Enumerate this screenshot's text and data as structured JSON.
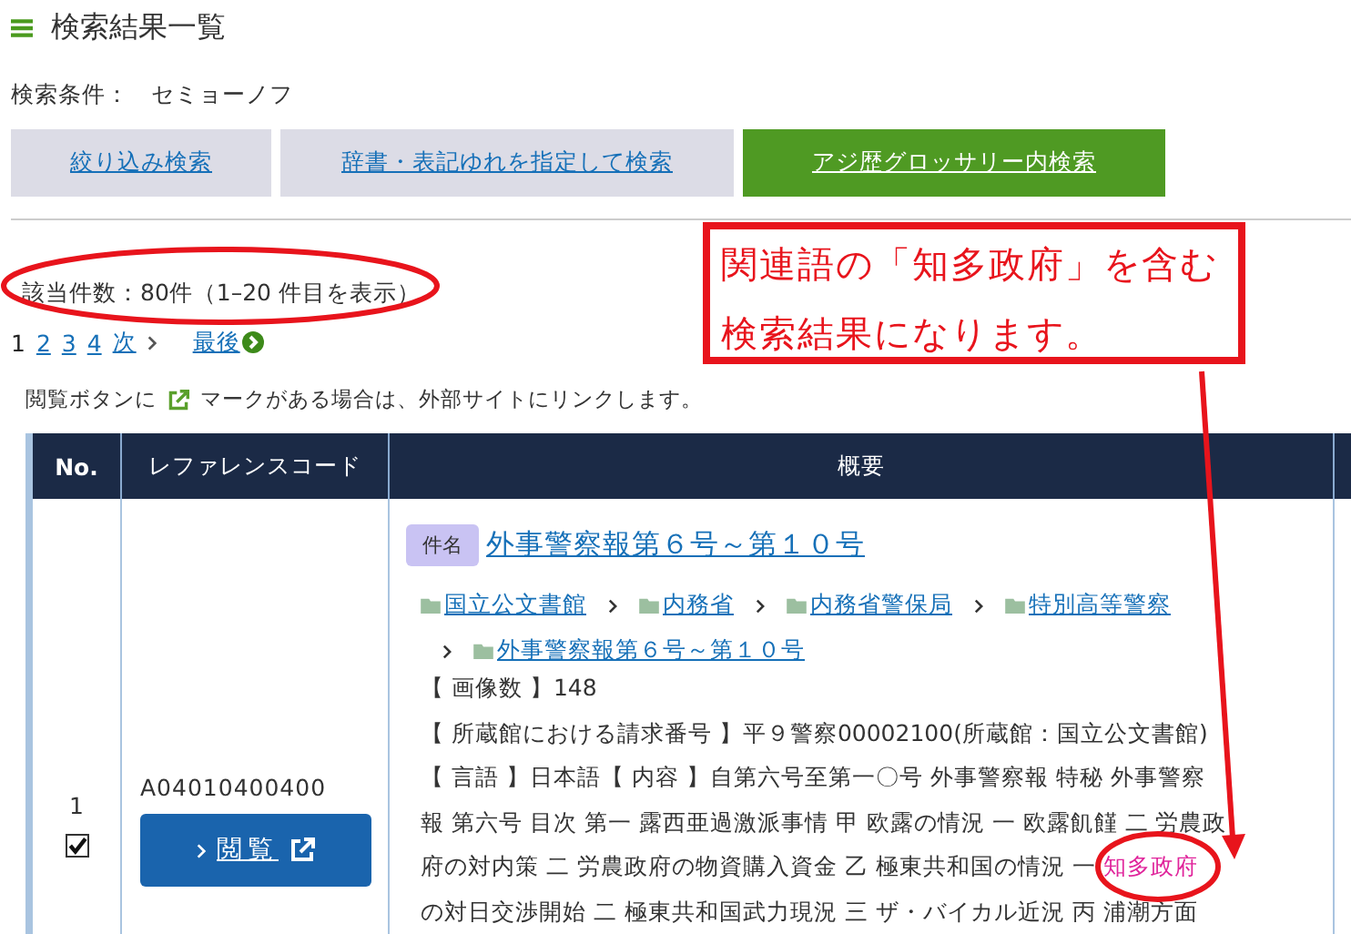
{
  "page_title": "検索結果一覧",
  "condition": {
    "label": "検索条件：",
    "value": "セミョーノフ"
  },
  "search_buttons": [
    {
      "label": "絞り込み検索",
      "selected": false
    },
    {
      "label": "辞書・表記ゆれを指定して検索",
      "selected": false
    },
    {
      "label": "アジ歴グロッサリー内検索",
      "selected": true
    }
  ],
  "result_count": "該当件数：80件（1–20 件目を表示）",
  "pagination": [
    {
      "label": "1",
      "selected": true
    },
    {
      "label": "2",
      "selected": false
    },
    {
      "label": "3",
      "selected": false
    },
    {
      "label": "4",
      "selected": false
    },
    {
      "label": "次",
      "selected": false
    }
  ],
  "last_link": "最後",
  "note": {
    "before": "閲覧ボタンに",
    "after": "マークがある場合は、外部サイトにリンクします。"
  },
  "table": {
    "columns": [
      "No.",
      "レファレンスコード",
      "概要"
    ],
    "rows": [
      {
        "no": "1",
        "checked": true,
        "reference_code": "A04010400400",
        "view_button": "閲覧",
        "title_tag": "件名",
        "title": "外事警察報第６号～第１０号",
        "breadcrumb": [
          "国立公文書館",
          "内務省",
          "内務省警保局",
          "特別高等警察",
          "外事警察報第６号～第１０号"
        ],
        "lines": [
          {
            "parts": [
              {
                "text": "【 画像数 】148",
                "highlight": false
              }
            ]
          },
          {
            "parts": [
              {
                "text": "【 所蔵館における請求番号 】平９警察00002100(所蔵館：国立公文書館)",
                "highlight": false
              }
            ]
          },
          {
            "parts": [
              {
                "text": "【 言語 】日本語【 内容 】自第六号至第一〇号 外事警察報 特秘 外事警察",
                "highlight": false
              }
            ]
          },
          {
            "parts": [
              {
                "text": "報 第六号 目次 第一 露西亜過激派事情 甲 欧露の情況 一 欧露飢饉 二 労農政",
                "highlight": false
              }
            ]
          },
          {
            "parts": [
              {
                "text": "府の対内策 二 労農政府の物資購入資金 乙 極東共和国の情況 一 ",
                "highlight": false
              },
              {
                "text": "知多政府",
                "highlight": true
              }
            ]
          },
          {
            "parts": [
              {
                "text": "の対日交渉開始 二 極東共和国武力現況 三 ザ・バイカル近況 丙 浦潮方面",
                "highlight": false
              }
            ]
          }
        ]
      }
    ]
  },
  "callout": "関連語の「知多政府」を含む検索結果になります。"
}
